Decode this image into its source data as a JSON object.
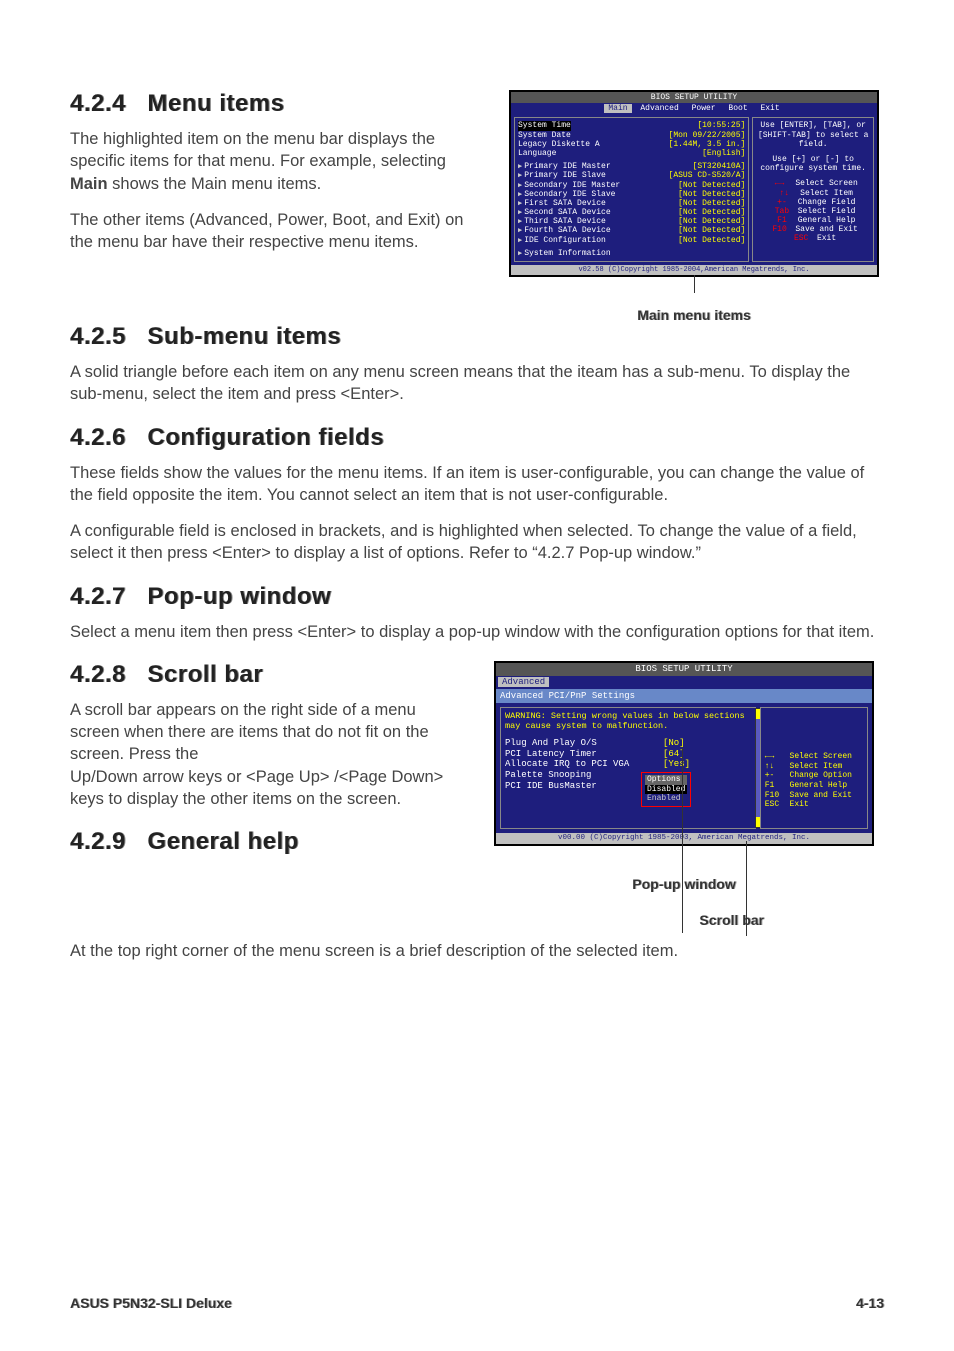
{
  "sections": {
    "s424": {
      "num": "4.2.4",
      "title": "Menu items",
      "p1a": "The highlighted item on the menu bar  displays the specific items for that menu. For example, selecting ",
      "p1b_bold": "Main",
      "p1c": " shows the Main menu items.",
      "p2": "The other items (Advanced, Power, Boot, and Exit) on the menu bar have their respective menu items."
    },
    "s425": {
      "num": "4.2.5",
      "title": "Sub-menu items",
      "p1": "A solid triangle before each item on any menu screen means that the iteam has a sub-menu. To display the sub-menu, select the item and press <Enter>."
    },
    "s426": {
      "num": "4.2.6",
      "title": "Configuration fields",
      "p1": "These fields show the values for the menu items. If an item is user-configurable, you can change the value of the field opposite the item. You cannot select an item that is not user-configurable.",
      "p2": "A configurable field is enclosed in brackets, and is highlighted when selected. To change the value of a field, select it then press <Enter> to display a list of options. Refer to “4.2.7 Pop-up window.”"
    },
    "s427": {
      "num": "4.2.7",
      "title": "Pop-up window",
      "p1": "Select a menu item then press <Enter> to display a pop-up window with the configuration options for that item."
    },
    "s428": {
      "num": "4.2.8",
      "title": "Scroll bar",
      "p1": "A scroll bar appears on the right side of a menu screen when there are items that do not fit on the screen. Press the",
      "p2": "Up/Down arrow keys or <Page Up> /<Page Down> keys to display the other items on the screen."
    },
    "s429": {
      "num": "4.2.9",
      "title": "General help",
      "p1": "At the top right corner of the menu screen is a brief description of the selected item."
    }
  },
  "captions": {
    "main_items": "Main menu items",
    "popup": "Pop-up window",
    "scrollbar": "Scroll bar"
  },
  "bios1": {
    "title": "BIOS SETUP UTILITY",
    "tabs": [
      "Main",
      "Advanced",
      "Power",
      "Boot",
      "Exit"
    ],
    "left_rows": [
      {
        "k": "System Time",
        "v": "[10:55:25]",
        "tri": false,
        "sel": true
      },
      {
        "k": "System Date",
        "v": "[Mon 09/22/2005]",
        "tri": false
      },
      {
        "k": "Legacy Diskette A",
        "v": "[1.44M, 3.5 in.]",
        "tri": false
      },
      {
        "k": "Language",
        "v": "[English]",
        "tri": false
      },
      {
        "k": "Primary IDE Master",
        "v": "[ST320410A]",
        "tri": true
      },
      {
        "k": "Primary IDE Slave",
        "v": "[ASUS CD-S520/A]",
        "tri": true
      },
      {
        "k": "Secondary IDE Master",
        "v": "[Not Detected]",
        "tri": true
      },
      {
        "k": "Secondary IDE Slave",
        "v": "[Not Detected]",
        "tri": true
      },
      {
        "k": "First SATA Device",
        "v": "[Not Detected]",
        "tri": true
      },
      {
        "k": "Second SATA Device",
        "v": "[Not Detected]",
        "tri": true
      },
      {
        "k": "Third SATA Device",
        "v": "[Not Detected]",
        "tri": true
      },
      {
        "k": "Fourth SATA Device",
        "v": "[Not Detected]",
        "tri": true
      },
      {
        "k": "IDE Configuration",
        "v": "[Not Detected]",
        "tri": true
      },
      {
        "k": "System Information",
        "v": "",
        "tri": true
      }
    ],
    "right_help": "Use [ENTER], [TAB], or [SHIFT-TAB] to select a field.",
    "right_help2": "Use [+] or [-] to configure system time.",
    "right_keys": [
      {
        "k": "←→",
        "v": "Select Screen"
      },
      {
        "k": "↑↓",
        "v": "Select Item"
      },
      {
        "k": "+-",
        "v": "Change Field"
      },
      {
        "k": "Tab",
        "v": "Select Field"
      },
      {
        "k": "F1",
        "v": "General Help"
      },
      {
        "k": "F10",
        "v": "Save and Exit"
      },
      {
        "k": "ESC",
        "v": "Exit"
      }
    ],
    "footer": "v02.58 (C)Copyright 1985-2004,American Megatrends, Inc."
  },
  "bios2": {
    "title": "BIOS SETUP UTILITY",
    "tab_active": "Advanced",
    "subheader": "Advanced PCI/PnP Settings",
    "warning": "WARNING: Setting wrong values in below sections may cause system to malfunction.",
    "rows": [
      {
        "k": "Plug And Play O/S",
        "v": "[No]"
      },
      {
        "k": "PCI Latency Timer",
        "v": "[64]"
      },
      {
        "k": "Allocate IRQ to PCI VGA",
        "v": "[Yes]"
      },
      {
        "k": "Palette Snooping",
        "v": ""
      },
      {
        "k": "PCI IDE BusMaster",
        "v": ""
      }
    ],
    "popup": {
      "header": "Options",
      "options": [
        "Disabled",
        "Enabled"
      ],
      "selected": 0
    },
    "right_keys": [
      {
        "k": "←→",
        "v": "Select Screen"
      },
      {
        "k": "↑↓",
        "v": "Select Item"
      },
      {
        "k": "+-",
        "v": "Change Option"
      },
      {
        "k": "F1",
        "v": "General Help"
      },
      {
        "k": "F10",
        "v": "Save and Exit"
      },
      {
        "k": "ESC",
        "v": "Exit"
      }
    ],
    "footer": "v00.00 (C)Copyright 1985-2003, American Megatrends, Inc."
  },
  "footer": {
    "left": "ASUS P5N32-SLI Deluxe",
    "right": "4-13"
  }
}
